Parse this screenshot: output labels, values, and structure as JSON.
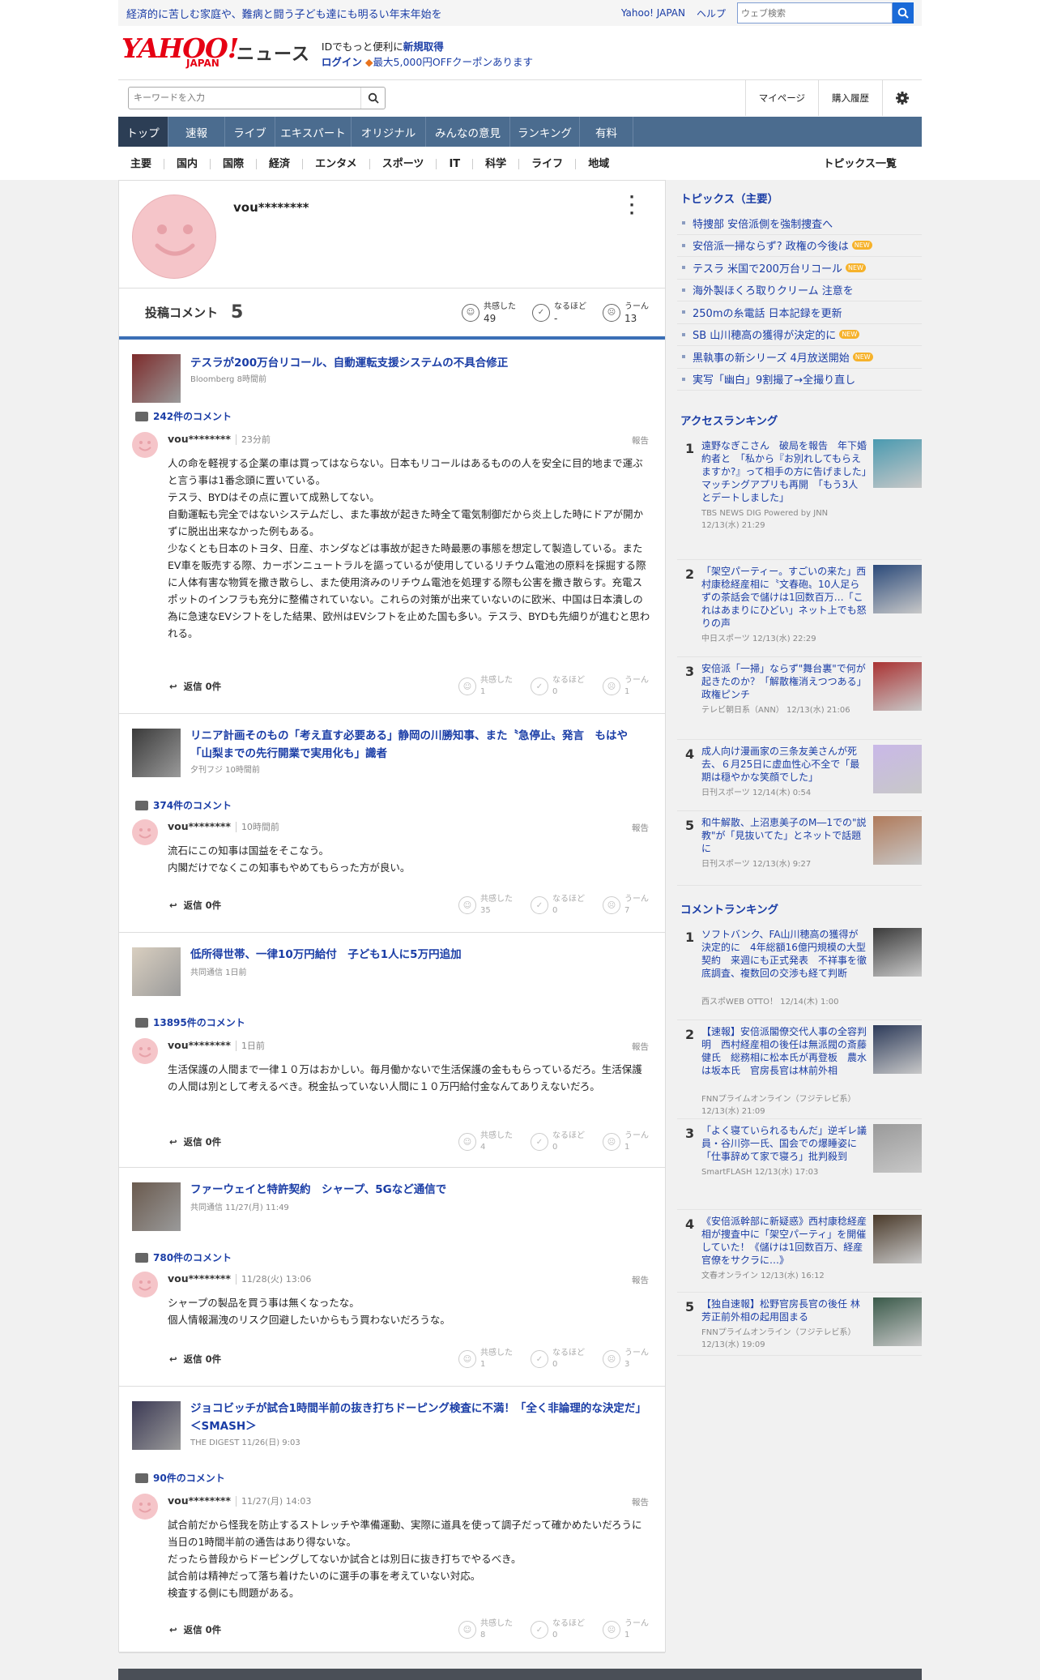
{
  "topbar": {
    "message": "経済的に苦しむ家庭や、難病と闘う子ども達にも明るい年末年始を",
    "yahoo_japan": "Yahoo! JAPAN",
    "help": "ヘルプ",
    "web_search_placeholder": "ウェブ検索"
  },
  "brand": {
    "logo_text": "YAHOO!",
    "logo_sub": "JAPAN",
    "service": "ニュース",
    "promo_line1_a": "IDでもっと便利に",
    "promo_line1_b": "新規取得",
    "promo_line2_a": "ログイン",
    "promo_line2_b": "最大5,000円OFFクーポンあります"
  },
  "search": {
    "placeholder": "キーワードを入力",
    "mypage": "マイページ",
    "history": "購入履歴"
  },
  "nav_tabs": [
    "トップ",
    "速報",
    "ライブ",
    "エキスパート",
    "オリジナル",
    "みんなの意見",
    "ランキング",
    "有料"
  ],
  "categories": [
    "主要",
    "国内",
    "国際",
    "経済",
    "エンタメ",
    "スポーツ",
    "IT",
    "科学",
    "ライフ",
    "地域"
  ],
  "topics_list_link": "トピックス一覧",
  "profile": {
    "username": "vou********",
    "posted_label": "投稿コメント",
    "posted_count": "5",
    "empathy_label": "共感した",
    "empathy_count": "49",
    "naruhodo_label": "なるほど",
    "naruhodo_count": "-",
    "uun_label": "うーん",
    "uun_count": "13"
  },
  "posts": [
    {
      "title": "テスラが200万台リコール、自動運転支援システムの不具合修正",
      "source": "Bloomberg 8時間前",
      "comment_count": "242件のコメント",
      "user": "vou********",
      "time": "23分前",
      "report": "報告",
      "body": "人の命を軽視する企業の車は買ってはならない。日本もリコールはあるものの人を安全に目的地まで運ぶと言う事は1番念頭に置いている。\nテスラ、BYDはその点に置いて成熟してない。\n自動運転も完全ではないシステムだし、また事故が起きた時全て電気制御だから炎上した時にドアが開かずに脱出出来なかった例もある。\n少なくとも日本のトヨタ、日産、ホンダなどは事故が起きた時最悪の事態を想定して製造している。またEV車を販売する際、カーボンニュートラルを謳っているが使用しているリチウム電池の原料を採掘する際に人体有害な物質を撒き散らし、また使用済みのリチウム電池を処理する際も公害を撒き散らす。充電スポットのインフラも充分に整備されていない。これらの対策が出来ていないのに欧米、中国は日本潰しの為に急速なEVシフトをした結果、欧州はEVシフトを止めた国も多い。テスラ、BYDも先細りが進むと思われる。",
      "reply": "返信 0件",
      "empathy": "1",
      "naruhodo": "0",
      "uun": "1"
    },
    {
      "title": "リニア計画そのもの「考え直す必要ある」静岡の川勝知事、また〝急停止〟発言　もはや「山梨までの先行開業で実用化も」識者",
      "source": "夕刊フジ 10時間前",
      "comment_count": "374件のコメント",
      "user": "vou********",
      "time": "10時間前",
      "report": "報告",
      "body": "流石にこの知事は国益をそこなう。\n内閣だけでなくこの知事もやめてもらった方が良い。",
      "reply": "返信 0件",
      "empathy": "35",
      "naruhodo": "0",
      "uun": "7"
    },
    {
      "title": "低所得世帯、一律10万円給付　子ども1人に5万円追加",
      "source": "共同通信 1日前",
      "comment_count": "13895件のコメント",
      "user": "vou********",
      "time": "1日前",
      "report": "報告",
      "body": "生活保護の人間まで一律１０万はおかしい。毎月働かないで生活保護の金ももらっているだろ。生活保護の人間は別として考えるべき。税金払っていない人間に１０万円給付金なんてありえないだろ。",
      "reply": "返信 0件",
      "empathy": "4",
      "naruhodo": "0",
      "uun": "1"
    },
    {
      "title": "ファーウェイと特許契約　シャープ、5Gなど通信で",
      "source": "共同通信 11/27(月) 11:49",
      "comment_count": "780件のコメント",
      "user": "vou********",
      "time": "11/28(火) 13:06",
      "report": "報告",
      "body": "シャープの製品を買う事は無くなったな。\n個人情報漏洩のリスク回避したいからもう買わないだろうな。",
      "reply": "返信 0件",
      "empathy": "1",
      "naruhodo": "0",
      "uun": "3"
    },
    {
      "title": "ジョコビッチが試合1時間半前の抜き打ちドーピング検査に不満！「全く非論理的な決定だ」＜SMASH＞",
      "source": "THE DIGEST 11/26(日) 9:03",
      "comment_count": "90件のコメント",
      "user": "vou********",
      "time": "11/27(月) 14:03",
      "report": "報告",
      "body": "試合前だから怪我を防止するストレッチや準備運動、実際に道具を使って調子だって確かめたいだろうに当日の1時間半前の通告はあり得ないな。\nだったら普段からドーピングしてないか試合とは別日に抜き打ちでやるべき。\n試合前は精神だって落ち着けたいのに選手の事を考えていない対応。\n検査する側にも問題がある。",
      "reply": "返信 0件",
      "empathy": "8",
      "naruhodo": "0",
      "uun": "1"
    }
  ],
  "sidebar": {
    "topics_title": "トピックス（主要）",
    "topics": [
      {
        "text": "特捜部 安倍派側を強制捜査へ",
        "new": ""
      },
      {
        "text": "安倍派一掃ならず? 政権の今後は",
        "new": "NEW"
      },
      {
        "text": "テスラ 米国で200万台リコール",
        "new": "NEW"
      },
      {
        "text": "海外製ほくろ取りクリーム 注意を",
        "new": ""
      },
      {
        "text": "250mの糸電話 日本記録を更新",
        "new": ""
      },
      {
        "text": "SB 山川穂高の獲得が決定的に",
        "new": "NEW"
      },
      {
        "text": "黒執事の新シリーズ 4月放送開始",
        "new": "NEW"
      },
      {
        "text": "実写「幽白」9割撮了→全撮り直し",
        "new": ""
      }
    ],
    "access_title": "アクセスランキング",
    "access": [
      {
        "no": "1",
        "text": "遠野なぎこさん　破局を報告　年下婚約者と　「私から『お別れしてもらえますか?』って相手の方に告げました」　マッチングアプリも再開　「もう3人とデートしました」",
        "src": "TBS NEWS DIG Powered by JNN 12/13(水) 21:29"
      },
      {
        "no": "2",
        "text": "「架空パーティー。すごいの来た」西村康稔経産相に〝文春砲〟10人足らずの茶話会で儲けは1回数百万…「これはあまりにひどい」ネット上でも怒りの声",
        "src": "中日スポーツ 12/13(水) 22:29"
      },
      {
        "no": "3",
        "text": "安倍派「一掃」ならず\"舞台裏\"で何が起きたのか？「解散権消えつつある」政権ピンチ",
        "src": "テレビ朝日系（ANN） 12/13(水) 21:06"
      },
      {
        "no": "4",
        "text": "成人向け漫画家の三条友美さんが死去、６月25日に虚血性心不全で「最期は穏やかな笑顔でした」",
        "src": "日刊スポーツ 12/14(木) 0:54"
      },
      {
        "no": "5",
        "text": "和牛解散、上沼恵美子のM―1での\"説教\"が「見抜いてた」とネットで話題に",
        "src": "日刊スポーツ 12/13(水) 9:27"
      }
    ],
    "comment_title": "コメントランキング",
    "comment_rank": [
      {
        "no": "1",
        "text": "ソフトバンク、FA山川穂高の獲得が決定的に　4年総額16億円規模の大型契約　来週にも正式発表　不祥事を徹底調査、複数回の交渉も経て判断",
        "src": "西スポWEB OTTO！ 12/14(木) 1:00"
      },
      {
        "no": "2",
        "text": "【速報】安倍派閣僚交代人事の全容判明　西村経産相の後任は無派閥の斎藤健氏　総務相に松本氏が再登板　農水は坂本氏　官房長官は林前外相",
        "src": "FNNプライムオンライン（フジテレビ系） 12/13(水) 21:09"
      },
      {
        "no": "3",
        "text": "「よく寝ていられるもんだ」逆ギレ議員・谷川弥一氏、国会での爆睡姿に「仕事辞めて家で寝ろ」批判殺到",
        "src": "SmartFLASH 12/13(水) 17:03"
      },
      {
        "no": "4",
        "text": "《安倍派幹部に新疑惑》西村康稔経産相が捜査中に「架空パーティ」を開催していた！《儲けは1回数百万、経産官僚をサクラに…》",
        "src": "文春オンライン 12/13(水) 16:12"
      },
      {
        "no": "5",
        "text": "【独自速報】松野官房長官の後任 林芳正前外相の起用固まる",
        "src": "FNNプライムオンライン（フジテレビ系） 12/13(水) 19:09"
      }
    ]
  },
  "colors": {
    "link": "#1a3da6",
    "nav": "#4b6c8f",
    "nav_active": "#2c3e55",
    "accent_blue": "#3b6fb6",
    "new_badge": "#f6b22b",
    "avatar": "#f5c5c9"
  }
}
